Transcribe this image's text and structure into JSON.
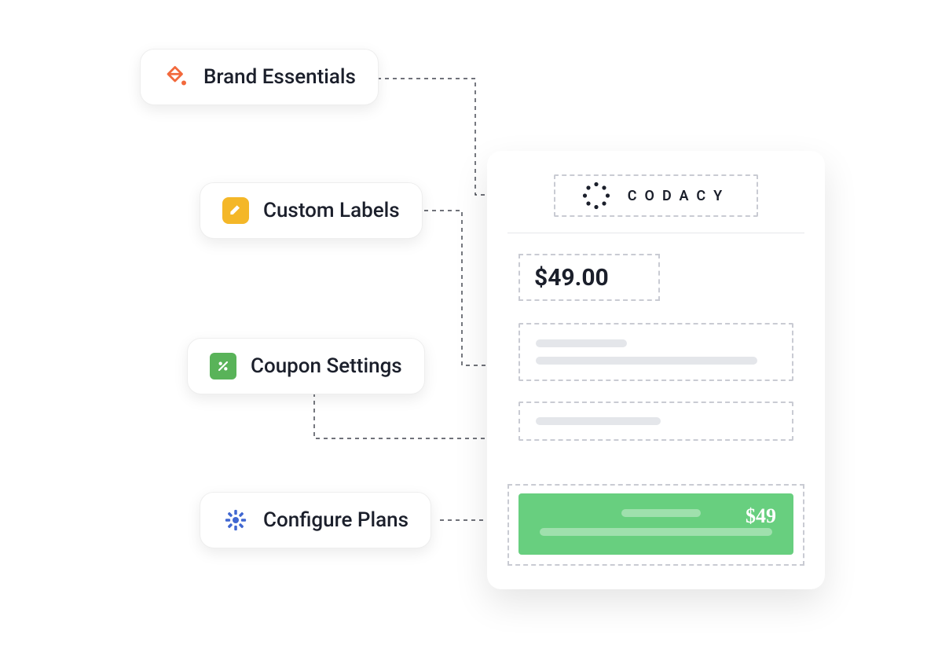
{
  "features": {
    "brand": {
      "label": "Brand Essentials"
    },
    "labels": {
      "label": "Custom Labels"
    },
    "coupon": {
      "label": "Coupon Settings"
    },
    "plans": {
      "label": "Configure Plans"
    }
  },
  "preview": {
    "brand_name": "CODACY",
    "price": "$49.00",
    "cta_price": "$49"
  },
  "colors": {
    "brand_icon": "#f2693c",
    "labels_icon": "#f4b728",
    "coupon_icon": "#59b359",
    "plans_icon": "#4067d1",
    "cta_bg": "#68cf7f"
  }
}
